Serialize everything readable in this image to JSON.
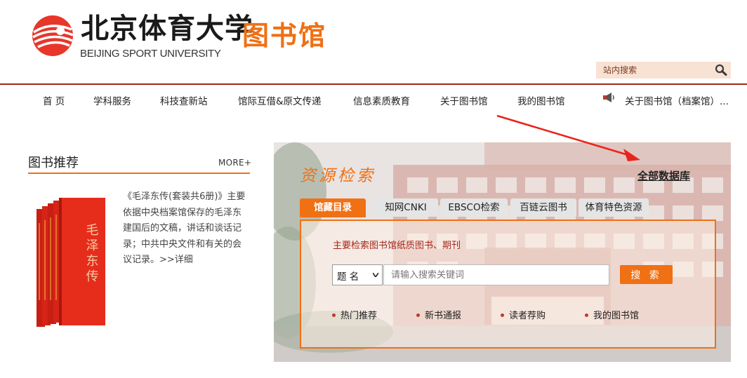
{
  "header": {
    "university_cn": "北京体育大学",
    "university_en": "BEIJING SPORT UNIVERSITY",
    "library_title": "图书馆",
    "site_search": {
      "placeholder": "站内搜索",
      "value": ""
    },
    "accent_color": "#f07014",
    "rule_color": "#9b2a1a"
  },
  "nav": {
    "items": [
      {
        "label": "首  页"
      },
      {
        "label": "学科服务"
      },
      {
        "label": "科技查新站"
      },
      {
        "label": "馆际互借&原文传递"
      },
      {
        "label": "信息素质教育"
      },
      {
        "label": "关于图书馆"
      },
      {
        "label": "我的图书馆"
      }
    ],
    "notice": "关于图书馆（档案馆）..."
  },
  "book_recommend": {
    "title": "图书推荐",
    "more": "MORE+",
    "book_spine_text": "毛泽东传",
    "description": "《毛泽东传(套装共6册)》主要依据中央档案馆保存的毛泽东建国后的文稿，讲话和谈话记录；中共中央文件和有关的会议记录。",
    "detail_link": ">>详细"
  },
  "resource_search": {
    "title": "资源检索",
    "all_databases": "全部数据库",
    "tabs": [
      {
        "label": "馆藏目录",
        "active": true
      },
      {
        "label": "知网CNKI",
        "active": false
      },
      {
        "label": "EBSCO检索",
        "active": false
      },
      {
        "label": "百链云图书",
        "active": false
      },
      {
        "label": "体育特色资源",
        "active": false
      }
    ],
    "hint": "主要检索图书馆纸质图书、期刊",
    "field_select": {
      "selected": "题 名"
    },
    "keyword_input": {
      "placeholder": "请输入搜索关键词",
      "value": ""
    },
    "search_button": "搜 索",
    "quick_links": [
      {
        "label": "热门推荐"
      },
      {
        "label": "新书通报"
      },
      {
        "label": "读者荐购"
      },
      {
        "label": "我的图书馆"
      }
    ]
  }
}
